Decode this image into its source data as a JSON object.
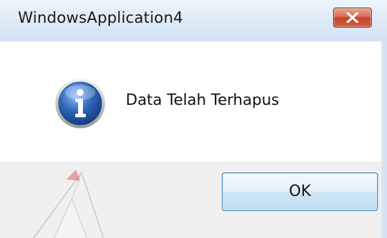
{
  "window": {
    "title": "WindowsApplication4",
    "close_icon": "close-icon"
  },
  "message": {
    "icon": "info-icon",
    "text": "Data Telah Terhapus"
  },
  "footer": {
    "ok_label": "OK"
  },
  "colors": {
    "close_button": "#c7442a",
    "ok_border": "#3c7fb1",
    "info_icon": "#2f67b8",
    "footer_bg": "#f0f0f0"
  }
}
